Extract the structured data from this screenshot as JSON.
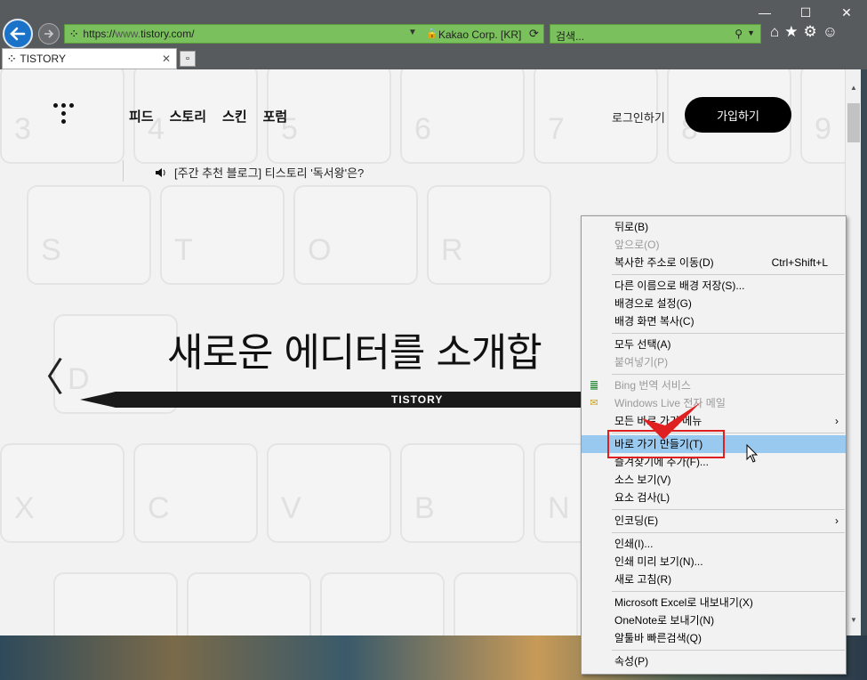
{
  "window_controls": {
    "minimize": "—",
    "maximize": "☐",
    "close": "✕"
  },
  "address_bar": {
    "scheme": "https://",
    "host": "www.",
    "domain": "tistory.com/",
    "cert_owner": "Kakao Corp. [KR]"
  },
  "search_bar": {
    "placeholder": "검색..."
  },
  "tab": {
    "title": "TISTORY",
    "favicon": "⁘"
  },
  "site": {
    "nav": [
      "피드",
      "스토리",
      "스킨",
      "포럼"
    ],
    "login_label": "로그인하기",
    "join_label": "가입하기",
    "notice": "[주간 추천 블로그] 티스토리 '독서왕'은?",
    "headline": "새로운 에디터를 소개합",
    "pencil_label": "TISTORY",
    "keyboard_keys": [
      "3",
      "4",
      "5",
      "6",
      "7",
      "8",
      "9",
      "S",
      "T",
      "O",
      "R",
      "X",
      "C",
      "V",
      "B",
      "N",
      "D"
    ]
  },
  "context_menu": {
    "items": [
      {
        "label": "뒤로(B)",
        "disabled": false
      },
      {
        "label": "앞으로(O)",
        "disabled": true
      },
      {
        "label": "복사한 주소로 이동(D)",
        "shortcut": "Ctrl+Shift+L",
        "disabled": false
      },
      {
        "label": "다른 이름으로 배경 저장(S)...",
        "disabled": false
      },
      {
        "label": "배경으로 설정(G)",
        "disabled": false
      },
      {
        "label": "배경 화면 복사(C)",
        "disabled": false
      },
      {
        "label": "모두 선택(A)",
        "disabled": false
      },
      {
        "label": "붙여넣기(P)",
        "disabled": true
      },
      {
        "label": "Bing 번역 서비스",
        "disabled": true,
        "icon": "bing-translate-icon"
      },
      {
        "label": "Windows Live 전자 메일",
        "disabled": true,
        "icon": "windows-live-mail-icon"
      },
      {
        "label": "모든 바로 가기 메뉴",
        "disabled": false,
        "submenu": true
      },
      {
        "label": "바로 가기 만들기(T)",
        "disabled": false,
        "highlighted": true
      },
      {
        "label": "즐겨찾기에 추가(F)...",
        "disabled": false
      },
      {
        "label": "소스 보기(V)",
        "disabled": false
      },
      {
        "label": "요소 검사(L)",
        "disabled": false
      },
      {
        "label": "인코딩(E)",
        "disabled": false,
        "submenu": true
      },
      {
        "label": "인쇄(I)...",
        "disabled": false
      },
      {
        "label": "인쇄 미리 보기(N)...",
        "disabled": false
      },
      {
        "label": "새로 고침(R)",
        "disabled": false
      },
      {
        "label": "Microsoft Excel로 내보내기(X)",
        "disabled": false
      },
      {
        "label": "OneNote로 보내기(N)",
        "disabled": false
      },
      {
        "label": "알툴바 빠른검색(Q)",
        "disabled": false
      },
      {
        "label": "속성(P)",
        "disabled": false
      }
    ]
  },
  "colors": {
    "address_bar_bg": "#7ac05c",
    "menu_highlight": "#99c9ef",
    "annotation_red": "#e02020"
  }
}
